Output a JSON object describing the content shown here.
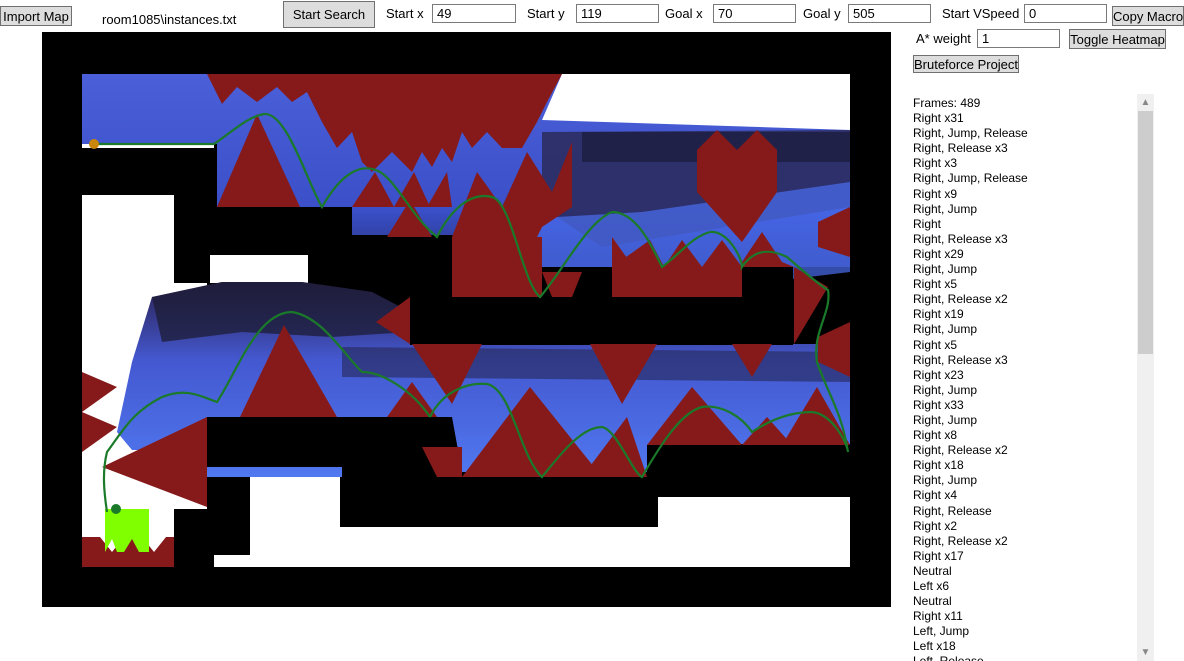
{
  "toolbar": {
    "import_map": "Import Map",
    "map_path": "room1085\\instances.txt",
    "start_search": "Start Search",
    "start_x_label": "Start x",
    "start_x_value": "49",
    "start_y_label": "Start y",
    "start_y_value": "119",
    "goal_x_label": "Goal x",
    "goal_x_value": "70",
    "goal_y_label": "Goal y",
    "goal_y_value": "505",
    "start_vspeed_label": "Start VSpeed",
    "start_vspeed_value": "0",
    "copy_macro": "Copy Macro",
    "astar_weight_label": "A* weight",
    "astar_weight_value": "1",
    "toggle_heatmap": "Toggle Heatmap",
    "bruteforce_project": "Bruteforce Project"
  },
  "log": {
    "frames": "Frames: 489",
    "lines": [
      "Right x31",
      "Right, Jump, Release",
      "Right, Release x3",
      "Right x3",
      "Right, Jump, Release",
      "Right x9",
      "Right, Jump",
      "Right",
      "Right, Release x3",
      "Right x29",
      "Right, Jump",
      "Right x5",
      "Right, Release x2",
      "Right x19",
      "Right, Jump",
      "Right x5",
      "Right, Release x3",
      "Right x23",
      "Right, Jump",
      "Right x33",
      "Right, Jump",
      "Right x8",
      "Right, Release x2",
      "Right x18",
      "Right, Jump",
      "Right x4",
      "Right, Release",
      "Right x2",
      "Right, Release x2",
      "Right x17",
      "Neutral",
      "Left x6",
      "Neutral",
      "Right x11",
      "Left, Jump",
      "Left x18",
      "Left, Release"
    ]
  },
  "scroll": {
    "up_icon": "▲",
    "down_icon": "▼"
  },
  "map_colors": {
    "wall": "#000000",
    "floor": "#ffffff",
    "spike": "#861a1a",
    "heat_blue": "#3a5ce0",
    "heat_dark": "#1e1e3c",
    "path": "#1a7a2a",
    "start_marker": "#c8860a",
    "goal": "#7fff00"
  }
}
